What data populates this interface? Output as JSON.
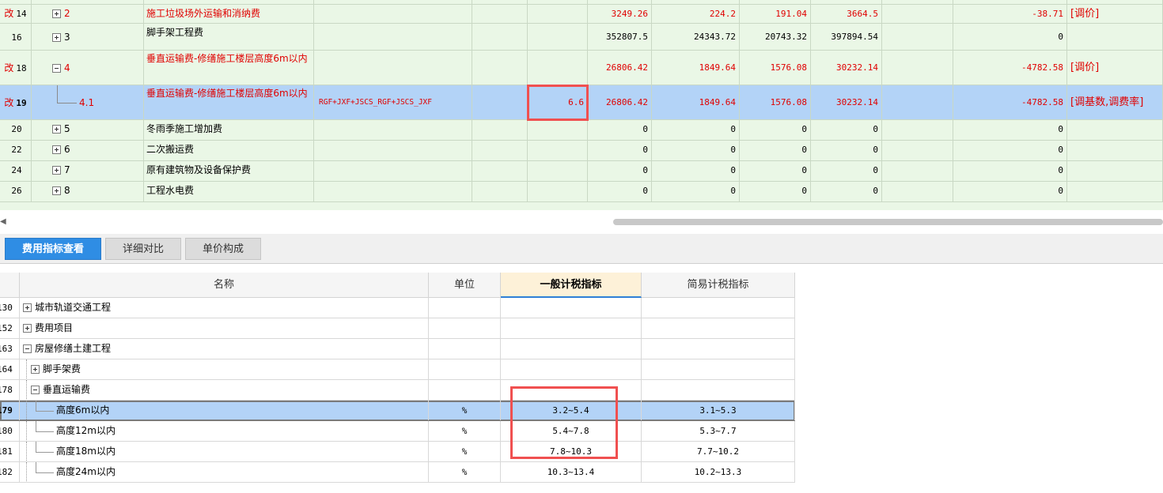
{
  "top_grid": {
    "rows": [
      {
        "no": "",
        "mark": "",
        "code": "",
        "name": "",
        "expr": "",
        "rate": "",
        "amount": "",
        "v1": "",
        "v2": "",
        "v3": "",
        "diff": "",
        "note": "",
        "red": true,
        "expander": "minus-partial"
      },
      {
        "no": "14",
        "mark": "改",
        "code": "2",
        "name": "施工垃圾场外运输和消纳费",
        "expr": "",
        "rate": "",
        "amount": "3249.26",
        "v1": "224.2",
        "v2": "191.04",
        "v3": "3664.5",
        "diff": "-38.71",
        "note": "[调价]",
        "red": true,
        "expander": "plus"
      },
      {
        "no": "16",
        "mark": "",
        "code": "3",
        "name": "脚手架工程费",
        "expr": "",
        "rate": "",
        "amount": "352807.5",
        "v1": "24343.72",
        "v2": "20743.32",
        "v3": "397894.54",
        "diff": "0",
        "note": "",
        "red": false,
        "expander": "plus"
      },
      {
        "no": "18",
        "mark": "改",
        "code": "4",
        "name": "垂直运输费-修缮施工楼层高度6m以内",
        "expr": "",
        "rate": "",
        "amount": "26806.42",
        "v1": "1849.64",
        "v2": "1576.08",
        "v3": "30232.14",
        "diff": "-4782.58",
        "note": "[调价]",
        "red": true,
        "expander": "minus"
      },
      {
        "no": "19",
        "mark": "改",
        "code": "4.1",
        "name": "垂直运输费-修缮施工楼层高度6m以内",
        "expr": "RGF+JXF+JSCS_RGF+JSCS_JXF",
        "rate": "6.6",
        "amount": "26806.42",
        "v1": "1849.64",
        "v2": "1576.08",
        "v3": "30232.14",
        "diff": "-4782.58",
        "note": "[调基数,调费率]",
        "red": true,
        "expander": "none"
      },
      {
        "no": "20",
        "mark": "",
        "code": "5",
        "name": "冬雨季施工增加费",
        "expr": "",
        "rate": "",
        "amount": "0",
        "v1": "0",
        "v2": "0",
        "v3": "0",
        "diff": "0",
        "note": "",
        "red": false,
        "expander": "plus"
      },
      {
        "no": "22",
        "mark": "",
        "code": "6",
        "name": "二次搬运费",
        "expr": "",
        "rate": "",
        "amount": "0",
        "v1": "0",
        "v2": "0",
        "v3": "0",
        "diff": "0",
        "note": "",
        "red": false,
        "expander": "plus"
      },
      {
        "no": "24",
        "mark": "",
        "code": "7",
        "name": "原有建筑物及设备保护费",
        "expr": "",
        "rate": "",
        "amount": "0",
        "v1": "0",
        "v2": "0",
        "v3": "0",
        "diff": "0",
        "note": "",
        "red": false,
        "expander": "plus"
      },
      {
        "no": "26",
        "mark": "",
        "code": "8",
        "name": "工程水电费",
        "expr": "",
        "rate": "",
        "amount": "0",
        "v1": "0",
        "v2": "0",
        "v3": "0",
        "diff": "0",
        "note": "",
        "red": false,
        "expander": "plus"
      }
    ],
    "selected_row": 4
  },
  "tabs": [
    {
      "label": "费用指标查看",
      "active": true
    },
    {
      "label": "详细对比",
      "active": false
    },
    {
      "label": "单价构成",
      "active": false
    }
  ],
  "bottom_grid": {
    "headers": {
      "name": "名称",
      "unit": "单位",
      "general": "一般计税指标",
      "simple": "简易计税指标"
    },
    "rows": [
      {
        "no": "130",
        "name": "城市轨道交通工程",
        "unit": "",
        "general": "",
        "simple": "",
        "level": 0,
        "expander": "plus"
      },
      {
        "no": "152",
        "name": "费用项目",
        "unit": "",
        "general": "",
        "simple": "",
        "level": 0,
        "expander": "plus"
      },
      {
        "no": "163",
        "name": "房屋修缮土建工程",
        "unit": "",
        "general": "",
        "simple": "",
        "level": 0,
        "expander": "minus"
      },
      {
        "no": "164",
        "name": "脚手架费",
        "unit": "",
        "general": "",
        "simple": "",
        "level": 1,
        "expander": "plus"
      },
      {
        "no": "178",
        "name": "垂直运输费",
        "unit": "",
        "general": "",
        "simple": "",
        "level": 1,
        "expander": "minus"
      },
      {
        "no": "179",
        "name": "高度6m以内",
        "unit": "%",
        "general": "3.2~5.4",
        "simple": "3.1~5.3",
        "level": 2,
        "expander": "none"
      },
      {
        "no": "180",
        "name": "高度12m以内",
        "unit": "%",
        "general": "5.4~7.8",
        "simple": "5.3~7.7",
        "level": 2,
        "expander": "none"
      },
      {
        "no": "181",
        "name": "高度18m以内",
        "unit": "%",
        "general": "7.8~10.3",
        "simple": "7.7~10.2",
        "level": 2,
        "expander": "none"
      },
      {
        "no": "182",
        "name": "高度24m以内",
        "unit": "%",
        "general": "10.3~13.4",
        "simple": "10.2~13.3",
        "level": 2,
        "expander": "none"
      }
    ],
    "selected_row": 5
  },
  "colors": {
    "grid_bg": "#eaf7e6",
    "selection": "#b3d3f7",
    "modified_text": "#e00000",
    "highlight_box": "#f05050",
    "active_tab": "#2f8de4"
  }
}
